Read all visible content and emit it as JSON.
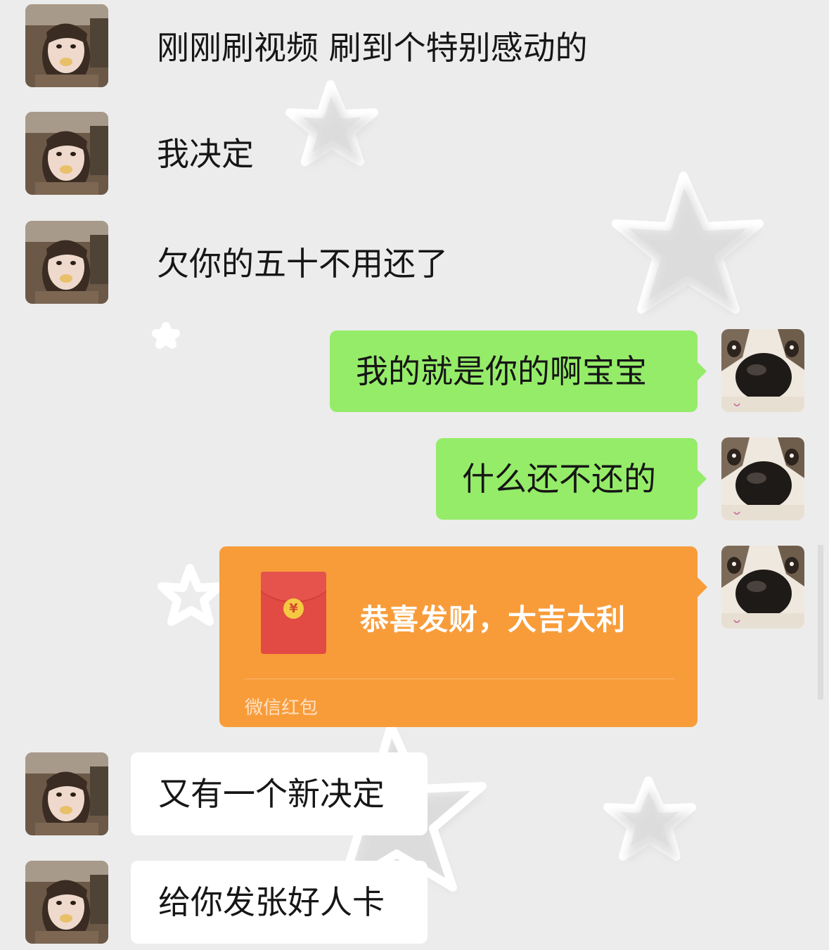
{
  "conversation": {
    "messages": [
      {
        "sender": "contact",
        "text": "刚刚刷视频 刷到个特别感动的"
      },
      {
        "sender": "contact",
        "text": "我决定"
      },
      {
        "sender": "contact",
        "text": "欠你的五十不用还了"
      },
      {
        "sender": "me",
        "text": "我的就是你的啊宝宝"
      },
      {
        "sender": "me",
        "text": "什么还不还的"
      },
      {
        "sender": "me",
        "type": "red-packet",
        "title": "恭喜发财，大吉大利",
        "coin_symbol": "¥",
        "footer": "微信红包"
      },
      {
        "sender": "contact",
        "text": "又有一个新决定"
      },
      {
        "sender": "contact",
        "text": "给你发张好人卡"
      }
    ]
  },
  "colors": {
    "chat_background": "#ececec",
    "incoming_bubble": "#ffffff",
    "outgoing_bubble": "#95ec69",
    "red_packet": "#f89c3a",
    "envelope": "#e24a44",
    "coin": "#f6c942"
  },
  "icons": {
    "contact_avatar": "girl-photo-avatar",
    "my_avatar": "dog-nose-avatar",
    "background": "star-pattern"
  }
}
